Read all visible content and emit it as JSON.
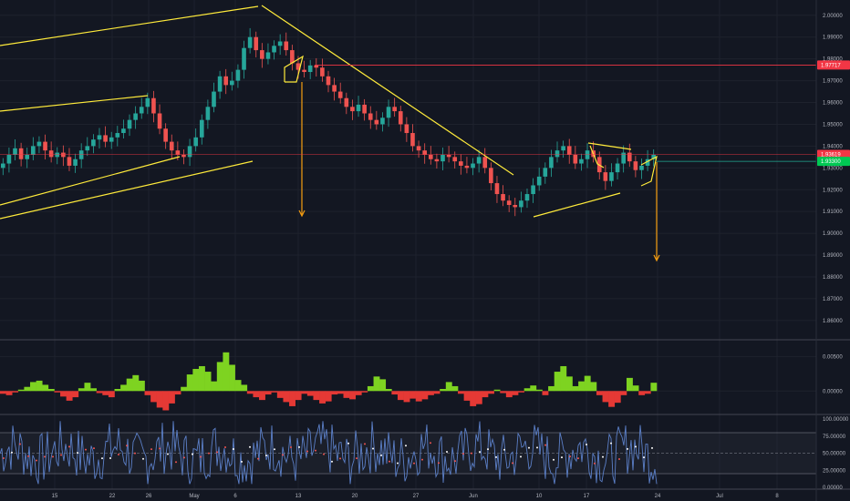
{
  "chart_data": {
    "type": "candlestick",
    "colors": {
      "background": "#131722",
      "grid": "#1e222d",
      "axis_text": "#b2b5be",
      "candle_up": "#26a69a",
      "candle_down": "#ef5350",
      "trendline": "#ffeb3b",
      "arrow": "#f59d10",
      "resistance": "#f23645",
      "support": "#22ab94",
      "hist_up": "#7ed321",
      "hist_down": "#e53935",
      "oscillator": "#5b7fc7"
    },
    "x_tick_labels": [
      "15",
      "22",
      "26",
      "May",
      "6",
      "13",
      "20",
      "27",
      "Jun",
      "10",
      "17",
      "24",
      "Jul",
      "8"
    ],
    "price_pane": {
      "ylim": [
        1.852,
        2.002
      ],
      "y_ticks": [
        "2.00000",
        "1.99000",
        "1.98000",
        "1.97000",
        "1.96000",
        "1.95000",
        "1.94000",
        "1.93000",
        "1.92000",
        "1.91000",
        "1.90000",
        "1.89000",
        "1.88000",
        "1.87000",
        "1.86000"
      ],
      "price_tags": [
        {
          "label": "1.97717",
          "value": 1.97717,
          "kind": "resistance"
        },
        {
          "label": "1.93619",
          "value": 1.93619,
          "kind": "current"
        },
        {
          "label": "1.93300",
          "value": 1.933,
          "kind": "support"
        }
      ],
      "close_series": [
        1.932,
        1.936,
        1.939,
        1.934,
        1.936,
        1.94,
        1.942,
        1.938,
        1.935,
        1.937,
        1.935,
        1.931,
        1.934,
        1.938,
        1.94,
        1.943,
        1.945,
        1.942,
        1.944,
        1.946,
        1.948,
        1.952,
        1.955,
        1.958,
        1.962,
        1.955,
        1.948,
        1.942,
        1.938,
        1.936,
        1.935,
        1.94,
        1.944,
        1.952,
        1.958,
        1.965,
        1.972,
        1.968,
        1.97,
        1.975,
        1.985,
        1.99,
        1.984,
        1.98,
        1.983,
        1.986,
        1.988,
        1.984,
        1.978,
        1.975,
        1.974,
        1.977,
        1.976,
        1.972,
        1.968,
        1.965,
        1.962,
        1.958,
        1.956,
        1.959,
        1.955,
        1.952,
        1.95,
        1.953,
        1.958,
        1.956,
        1.95,
        1.946,
        1.94,
        1.938,
        1.936,
        1.934,
        1.933,
        1.936,
        1.935,
        1.933,
        1.931,
        1.93,
        1.932,
        1.935,
        1.93,
        1.923,
        1.918,
        1.915,
        1.913,
        1.912,
        1.915,
        1.918,
        1.922,
        1.926,
        1.93,
        1.935,
        1.938,
        1.94,
        1.936,
        1.932,
        1.934,
        1.938,
        1.935,
        1.928,
        1.924,
        1.928,
        1.932,
        1.937,
        1.933,
        1.929,
        1.931,
        1.934,
        1.936
      ]
    },
    "momentum_pane": {
      "ylim": [
        -0.003,
        0.0065
      ],
      "y_ticks": [
        "0.00500",
        "0.00000"
      ],
      "values": [
        -0.0004,
        -0.0006,
        -0.0002,
        0.0002,
        0.0006,
        0.0013,
        0.0015,
        0.0009,
        0.0003,
        -0.0002,
        -0.0008,
        -0.0014,
        -0.0009,
        0.0004,
        0.0012,
        0.0004,
        -0.0003,
        -0.0006,
        -0.0009,
        0.0003,
        0.0009,
        0.0018,
        0.0023,
        0.0015,
        -0.0006,
        -0.0016,
        -0.0024,
        -0.0028,
        -0.0018,
        -0.0005,
        0.0006,
        0.0024,
        0.0032,
        0.0036,
        0.0028,
        0.0014,
        0.0042,
        0.0056,
        0.0038,
        0.0016,
        0.0009,
        -0.0004,
        -0.0009,
        -0.0013,
        -0.0005,
        -0.0002,
        -0.001,
        -0.0016,
        -0.0022,
        -0.0013,
        -0.0004,
        -0.0007,
        -0.0013,
        -0.0018,
        -0.0015,
        -0.0005,
        -0.0004,
        -0.001,
        -0.0012,
        -0.0006,
        -0.0002,
        0.0007,
        0.0021,
        0.0017,
        0.0003,
        -0.0005,
        -0.0013,
        -0.0016,
        -0.0011,
        -0.0015,
        -0.0012,
        -0.0006,
        -0.0004,
        0.0003,
        0.0013,
        0.0007,
        -0.0004,
        -0.0014,
        -0.0022,
        -0.0019,
        -0.0009,
        -0.0004,
        0.0002,
        -0.0003,
        -0.0009,
        -0.0006,
        -0.0002,
        0.0004,
        0.0008,
        0.0002,
        -0.0006,
        0.0007,
        0.0028,
        0.0036,
        0.0021,
        0.0007,
        0.0014,
        0.0022,
        0.0013,
        -0.0006,
        -0.0016,
        -0.0023,
        -0.0017,
        -0.0006,
        0.0019,
        0.0008,
        -0.0006,
        -0.0004,
        0.0012
      ]
    },
    "oscillator_pane": {
      "ylim": [
        0,
        100
      ],
      "y_ticks": [
        "100.00000",
        "75.00000",
        "50.00000",
        "25.00000",
        "0.00000"
      ],
      "levels": [
        80,
        50,
        20
      ]
    }
  }
}
